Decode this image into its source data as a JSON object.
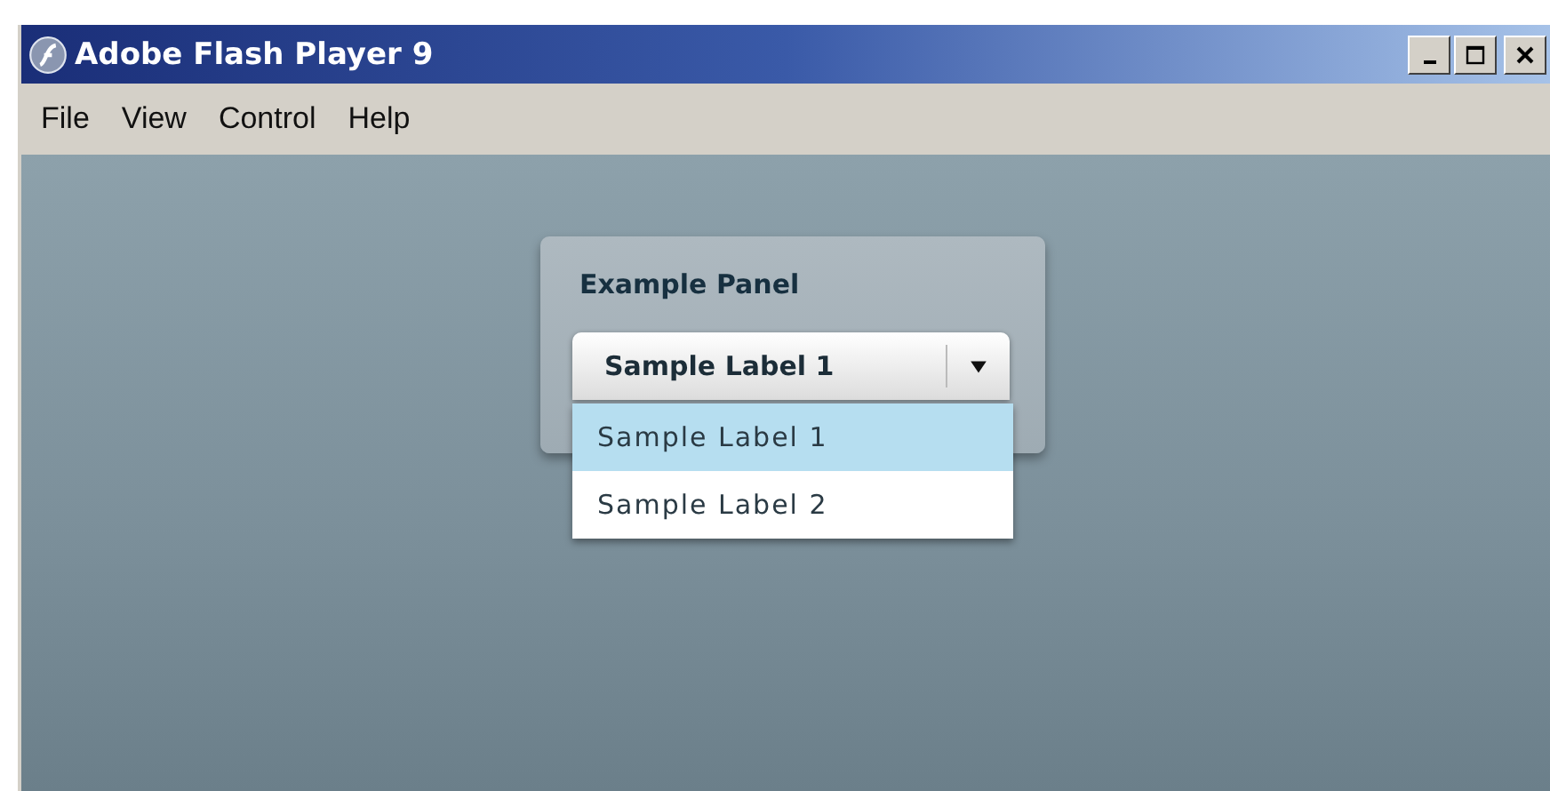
{
  "window": {
    "title": "Adobe Flash Player 9"
  },
  "menu": [
    "File",
    "View",
    "Control",
    "Help"
  ],
  "panel": {
    "title": "Example Panel",
    "combo": {
      "value": "Sample Label 1",
      "expanded": true,
      "options": [
        {
          "label": "Sample Label 1",
          "selected": true
        },
        {
          "label": "Sample Label 2",
          "selected": false
        }
      ]
    }
  }
}
